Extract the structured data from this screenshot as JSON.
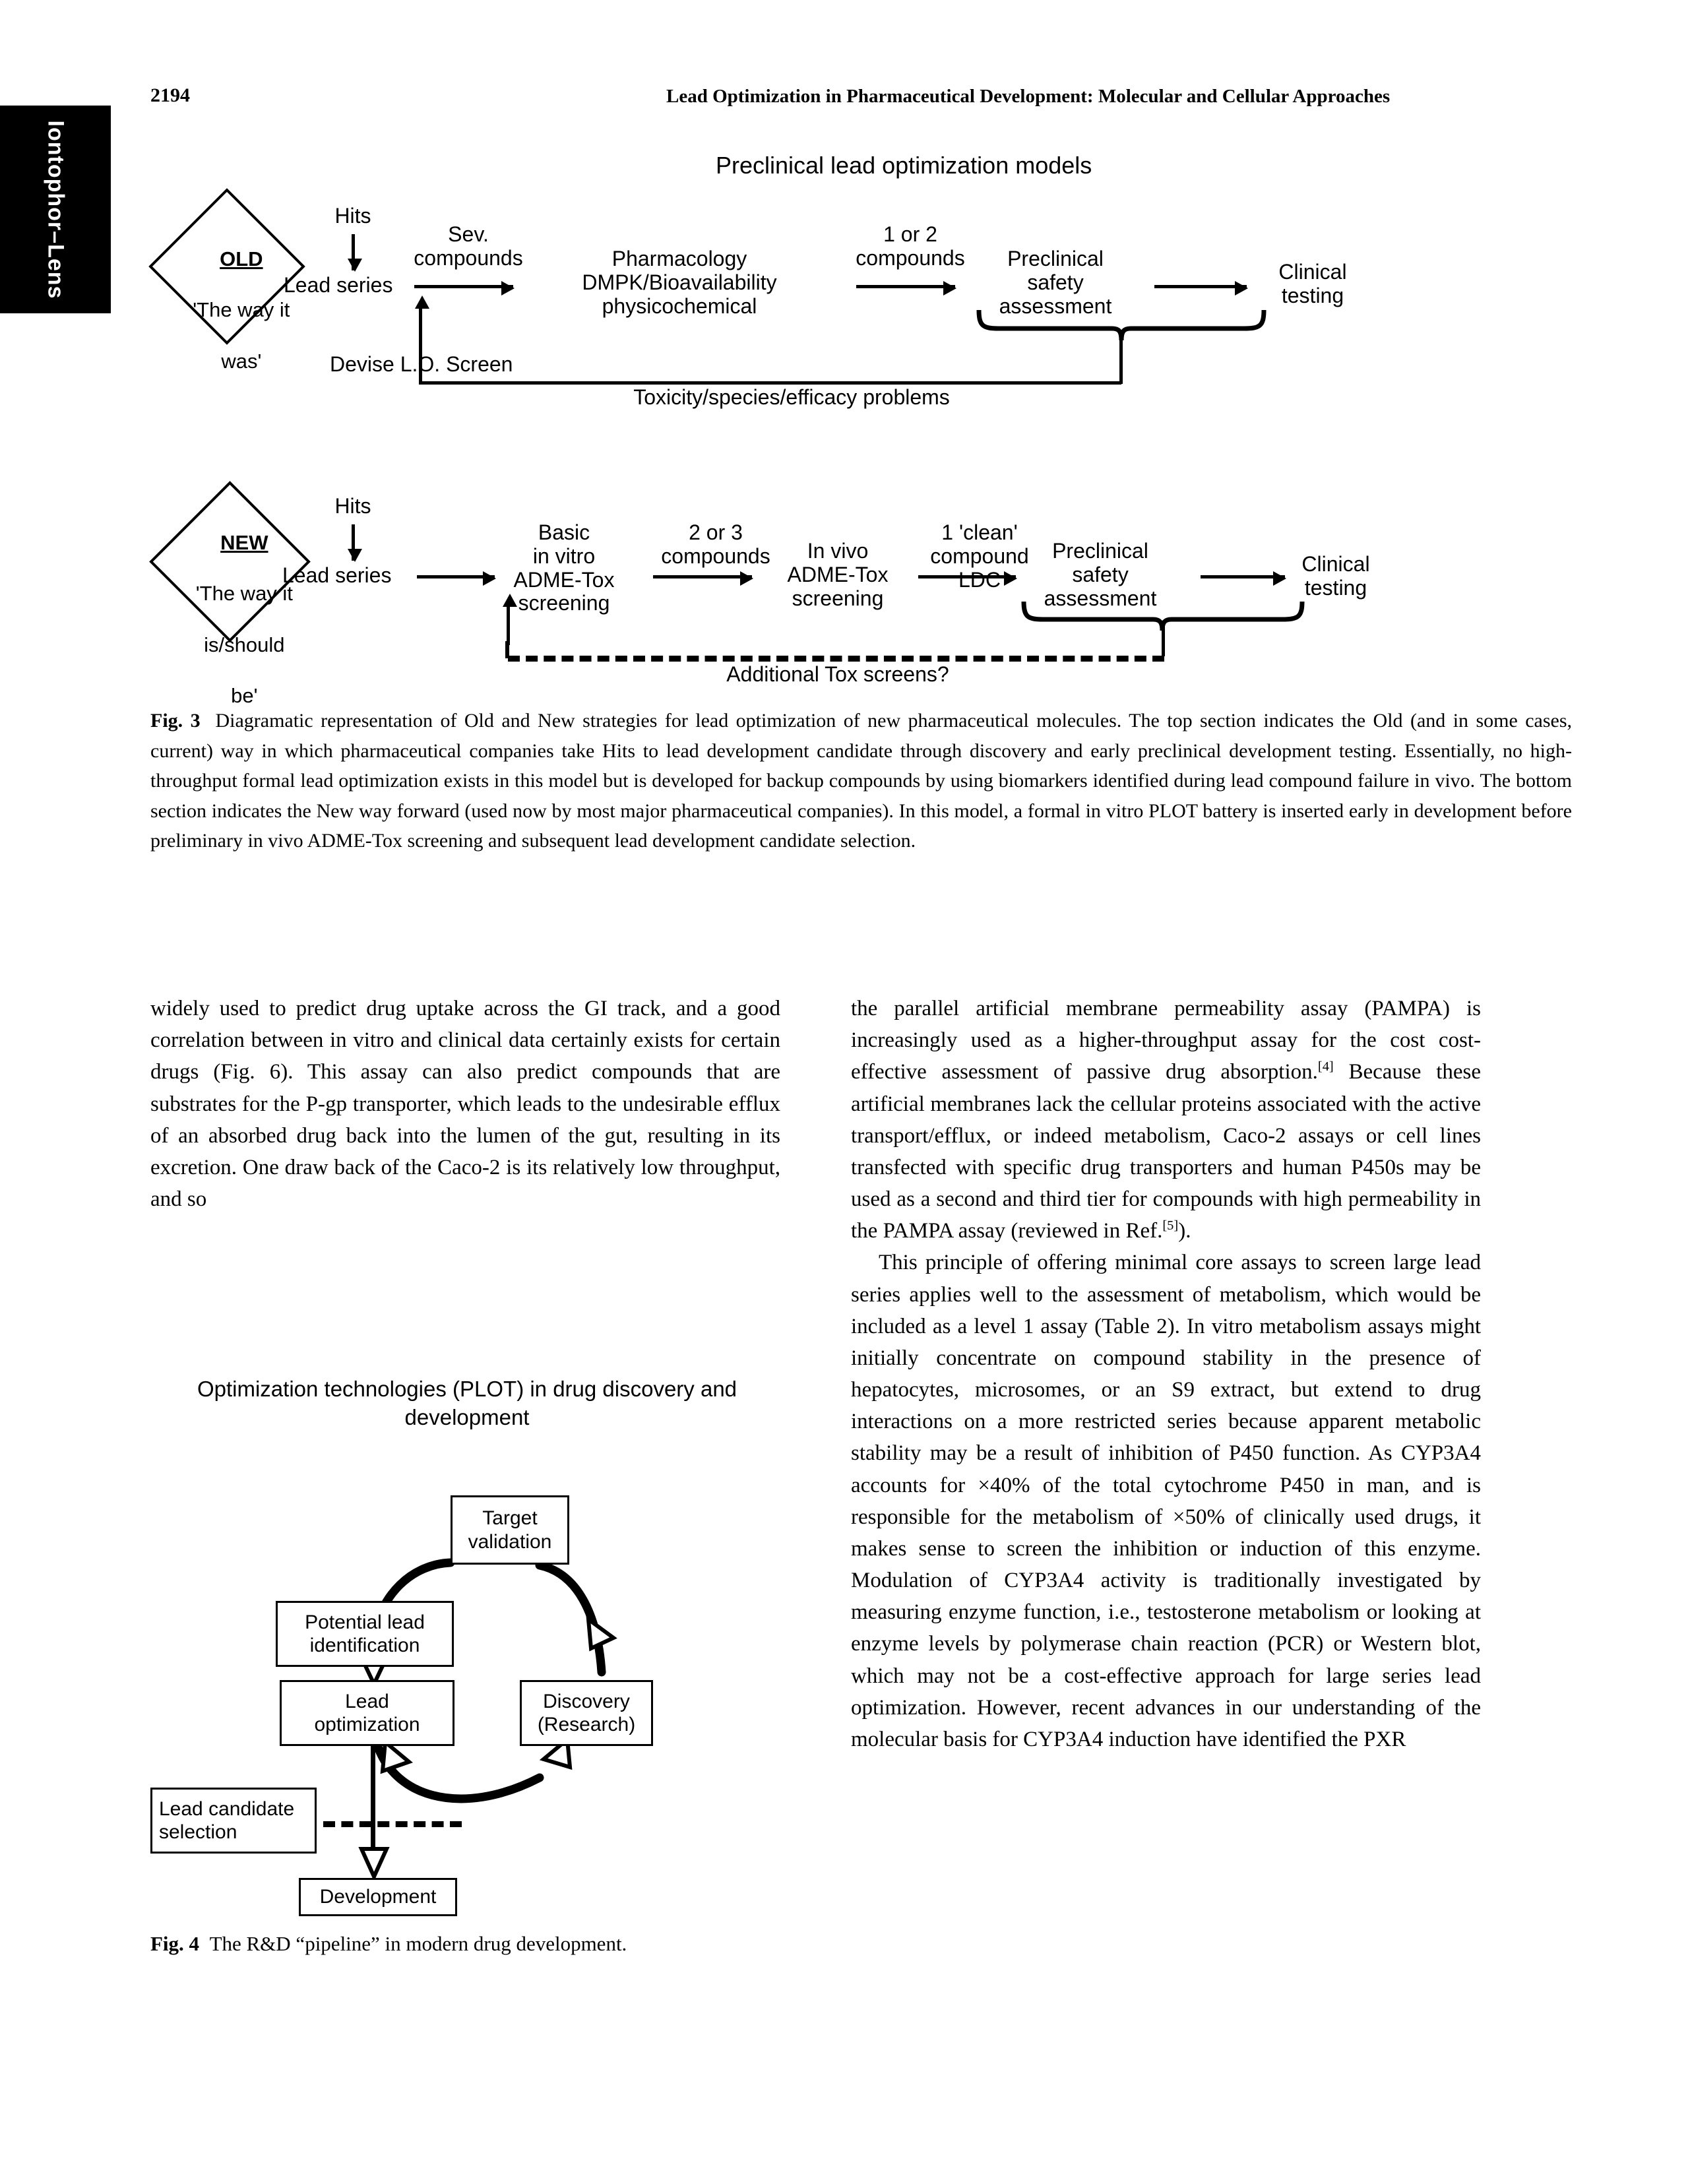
{
  "side_tab": {
    "label": "Iontophor–Lens"
  },
  "header": {
    "folio": "2194",
    "running_head": "Lead Optimization in Pharmaceutical Development: Molecular and Cellular Approaches"
  },
  "fig3": {
    "title": "Preclinical lead optimization models",
    "old_flow": {
      "diamond": {
        "heading": "OLD",
        "line1": "'The way it",
        "line2": "was'"
      },
      "hits_label": "Hits",
      "lead_series": "Lead series",
      "sev_compounds": "Sev.\ncompounds",
      "stage2": "Pharmacology\nDMPK/Bioavailability\nphysicochemical",
      "one_or_two": "1 or 2\ncompounds",
      "stage3": "Preclinical\nsafety\nassessment",
      "stage4": "Clinical\ntesting",
      "feedback_left": "Devise L.O. Screen",
      "feedback_bottom": "Toxicity/species/efficacy problems"
    },
    "new_flow": {
      "diamond": {
        "heading": "NEW",
        "line1": "'The way it",
        "line2": "is/should",
        "line3": "be'"
      },
      "hits_label": "Hits",
      "lead_series": "Lead series",
      "stage1": "Basic\nin vitro\nADME-Tox\nscreening",
      "two_or_three": "2 or 3\ncompounds",
      "stage2": "In vivo\nADME-Tox\nscreening",
      "one_clean": "1 'clean'\ncompound\nLDC",
      "stage3": "Preclinical\nsafety\nassessment",
      "stage4": "Clinical\ntesting",
      "feedback_bottom": "Additional Tox screens?"
    },
    "caption_lead": "Fig. 3",
    "caption_body": "Diagramatic representation of Old and New strategies for lead optimization of new pharmaceutical molecules. The top section indicates the Old (and in some cases, current) way in which pharmaceutical companies take Hits to lead development candidate through discovery and early preclinical development testing. Essentially, no high-throughput formal lead optimization exists in this model but is developed for backup compounds by using biomarkers identified during lead compound failure in vivo. The bottom section indicates the New way forward (used now by most major pharmaceutical companies). In this model, a formal in vitro PLOT battery is inserted early in development before preliminary in vivo ADME-Tox screening and subsequent lead development candidate selection."
  },
  "fig4": {
    "title": "Optimization technologies (PLOT) in drug\ndiscovery and development",
    "boxes": {
      "target_validation": "Target\nvalidation",
      "potential_lead": "Potential lead\nidentification",
      "lead_optimization": "Lead\noptimization",
      "discovery": "Discovery\n(Research)",
      "lead_candidate": "Lead candidate\nselection",
      "development": "Development"
    },
    "caption_lead": "Fig. 4",
    "caption_body": "The R&D “pipeline” in modern drug development."
  },
  "body": {
    "left_column": [
      "widely used to predict drug uptake across the GI track, and a good correlation between in vitro and clinical data certainly exists for certain drugs (Fig. 6). This assay can also predict compounds that are substrates for the P-gp transporter, which leads to the undesirable efflux of an absorbed drug back into the lumen of the gut, resulting in its excretion. One draw back of the Caco-2 is its relatively low throughput, and so"
    ],
    "right_column": {
      "para1_a": "the parallel artificial membrane permeability assay (PAMPA) is increasingly used as a higher-throughput assay for the cost cost-effective assessment of passive drug absorption.",
      "para1_ref1": "[4]",
      "para1_b": " Because these artificial membranes lack the cellular proteins associated with the active transport/efflux, or indeed metabolism, Caco-2 assays or cell lines transfected with specific drug transporters and human P450s may be used as a second and third tier for compounds with high permeability in the PAMPA assay (reviewed in Ref.",
      "para1_ref2": "[5]",
      "para1_c": ").",
      "para2": "This principle of offering minimal core assays to screen large lead series applies well to the assessment of metabolism, which would be included as a level 1 assay (Table 2). In vitro metabolism assays might initially concentrate on compound stability in the presence of hepatocytes, microsomes, or an S9 extract, but extend to drug interactions on a more restricted series because apparent metabolic stability may be a result of inhibition of P450 function. As CYP3A4 accounts for ×40% of the total cytochrome P450 in man, and is responsible for the metabolism of ×50% of clinically used drugs, it makes sense to screen the inhibition or induction of this enzyme. Modulation of CYP3A4 activity is traditionally investigated by measuring enzyme function, i.e., testosterone metabolism or looking at enzyme levels by polymerase chain reaction (PCR) or Western blot, which may not be a cost-effective approach for large series lead optimization. However, recent advances in our understanding of the molecular basis for CYP3A4 induction have identified the PXR"
    }
  },
  "colors": {
    "ink": "#000000",
    "paper": "#ffffff"
  }
}
